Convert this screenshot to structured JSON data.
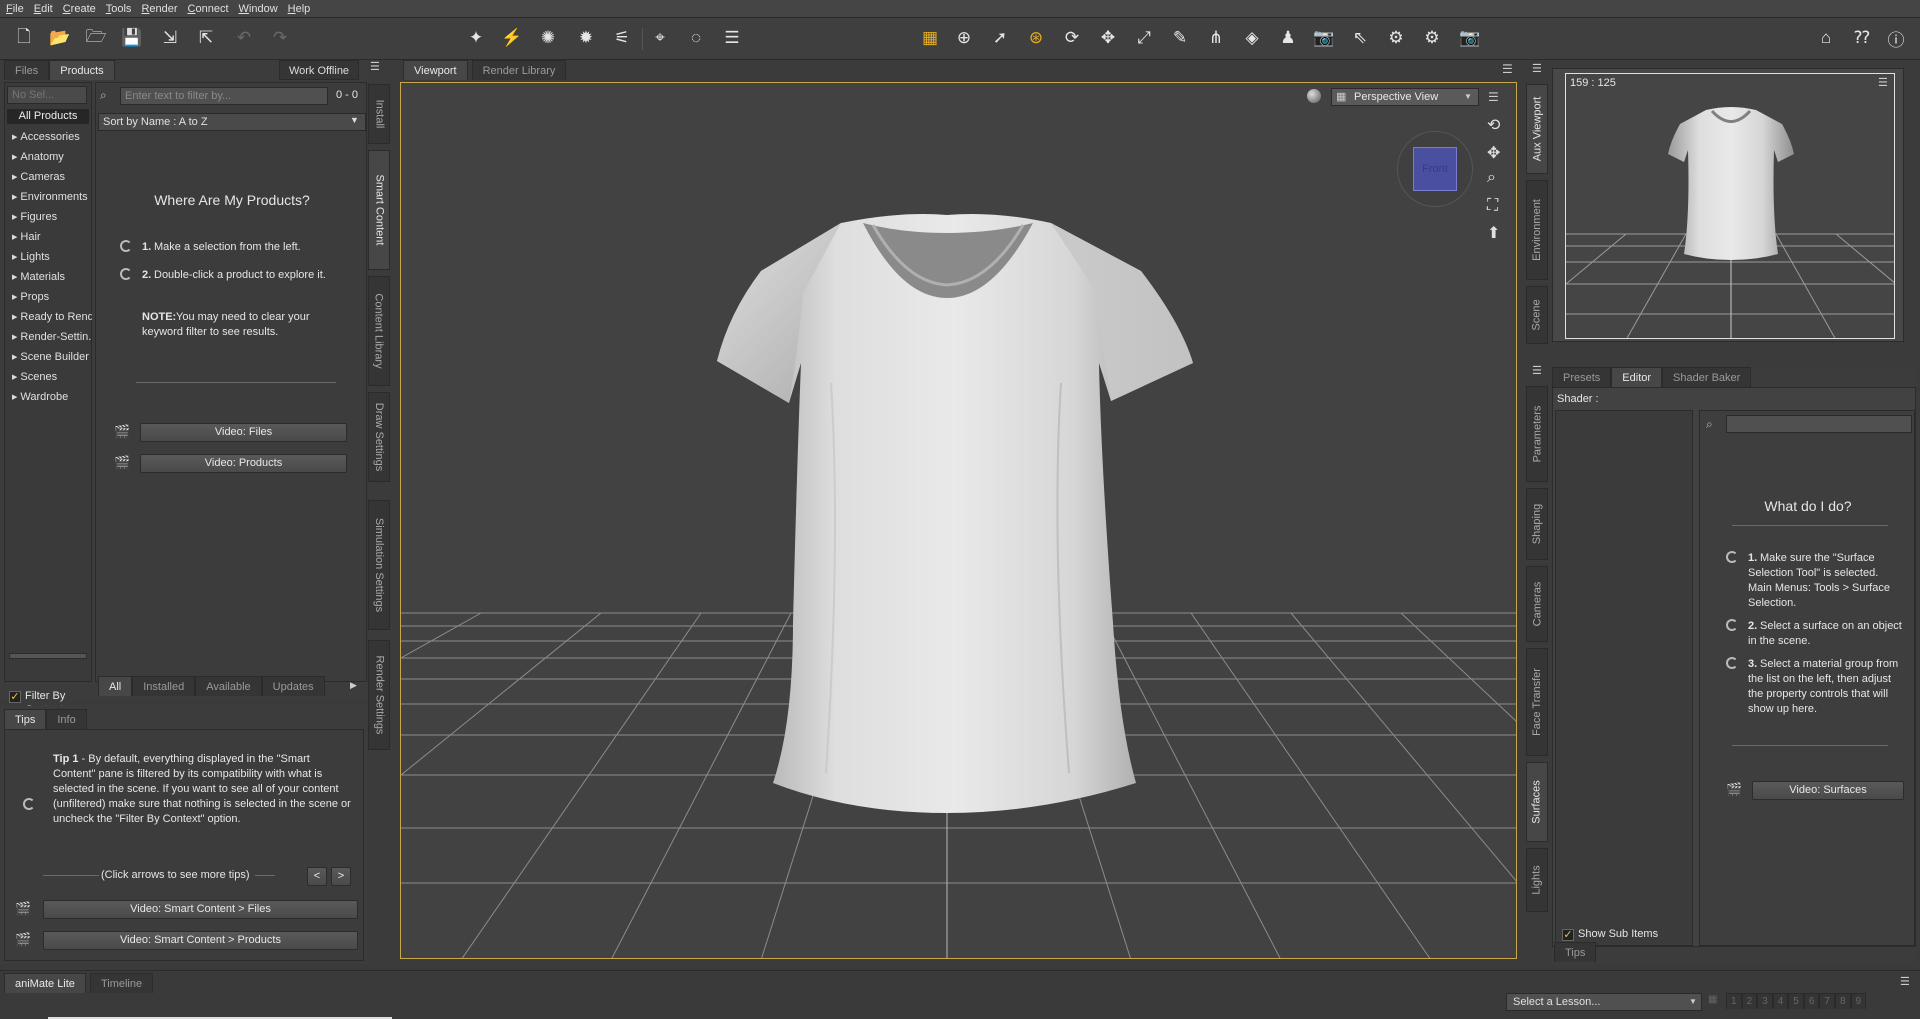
{
  "menu": [
    "File",
    "Edit",
    "Create",
    "Tools",
    "Render",
    "Connect",
    "Window",
    "Help"
  ],
  "toolbar_icons": [
    "new-file-icon",
    "open-file-icon",
    "merge-file-icon",
    "save-icon",
    "import-icon",
    "export-icon",
    "undo-icon",
    "redo-icon",
    "layout-icon"
  ],
  "left": {
    "tabs": [
      "Files",
      "Products"
    ],
    "work_offline": "Work Offline",
    "category_selector": "No Sel...",
    "all_products": "All Products",
    "categories": [
      "Accessories",
      "Anatomy",
      "Cameras",
      "Environments",
      "Figures",
      "Hair",
      "Lights",
      "Materials",
      "Props",
      "Ready to Rend...",
      "Render-Settin...",
      "Scene Builder",
      "Scenes",
      "Wardrobe"
    ],
    "filter_placeholder": "Enter text to filter by...",
    "result_count": "0 - 0",
    "sort": "Sort by Name : A to Z",
    "heading": "Where Are My Products?",
    "step1_num": "1.",
    "step1": "Make a selection from the left.",
    "step2_num": "2.",
    "step2": "Double-click a product to explore it.",
    "note_label": "NOTE:",
    "note": "You may need to clear your keyword filter to see results.",
    "video_files": "Video: Files",
    "video_products": "Video: Products",
    "filter_by_context": "Filter By Context",
    "filter_tabs": [
      "All",
      "Installed",
      "Available",
      "Updates"
    ],
    "vtabs": [
      "Install",
      "Smart Content",
      "Content Library",
      "Draw Settings",
      "Simulation Settings",
      "Render Settings"
    ]
  },
  "tips": {
    "tabs": [
      "Tips",
      "Info"
    ],
    "tip_label": "Tip 1",
    "tip_text": " - By default, everything displayed in the \"Smart Content\" pane is filtered by its compatibility with what is selected in the scene. If you want to see all of your content (unfiltered) make sure that nothing is selected in the scene or uncheck the \"Filter By Context\" option.",
    "hint": "(Click arrows to see more tips)",
    "prev": "<",
    "next": ">",
    "video1": "Video: Smart Content > Files",
    "video2": "Video: Smart Content > Products"
  },
  "viewport": {
    "tabs": [
      "Viewport",
      "Render Library"
    ],
    "view_mode": "Perspective View",
    "cube_label": "Front"
  },
  "aux": {
    "resolution": "159 : 125",
    "vtabs": [
      "Aux Viewport",
      "Environment",
      "Scene"
    ]
  },
  "surfaces": {
    "tabs": [
      "Presets",
      "Editor",
      "Shader Baker"
    ],
    "shader_label": "Shader :",
    "heading": "What do I do?",
    "step1_num": "1.",
    "step1": "Make sure the \"Surface Selection Tool\" is selected. Main Menus: Tools > Surface Selection.",
    "step2_num": "2.",
    "step2": "Select a surface on an object in the scene.",
    "step3_num": "3.",
    "step3": "Select a material group from the list on the left, then adjust the property controls that will show up here.",
    "video": "Video: Surfaces",
    "show_sub_items": "Show Sub Items",
    "tips_tab": "Tips",
    "vtabs": [
      "Parameters",
      "Shaping",
      "Cameras",
      "Face Transfer",
      "Surfaces",
      "Lights"
    ]
  },
  "bottom": {
    "tabs": [
      "aniMate Lite",
      "Timeline"
    ],
    "lesson": "Select a Lesson...",
    "lesson_steps": [
      "1",
      "2",
      "3",
      "4",
      "5",
      "6",
      "7",
      "8",
      "9"
    ]
  },
  "colors": {
    "accent": "#c9a84a",
    "cube": "#4b4fa0"
  }
}
